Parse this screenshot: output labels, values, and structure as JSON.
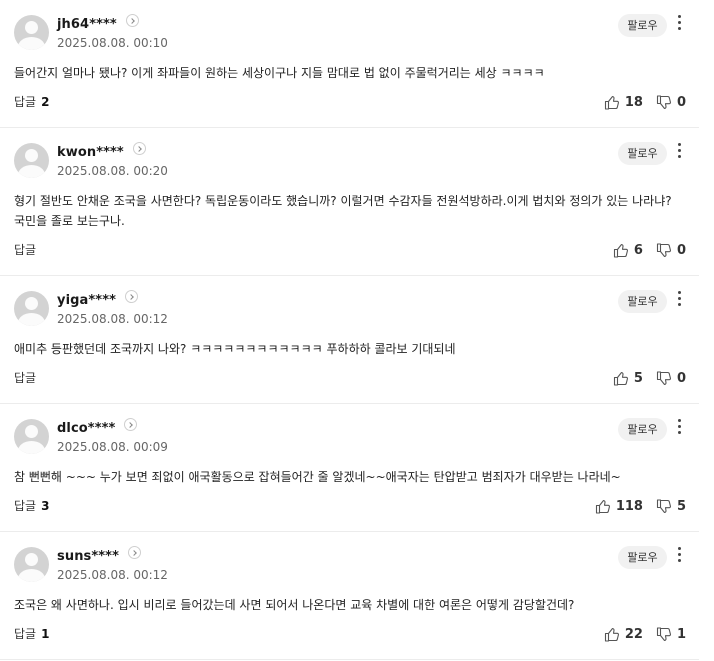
{
  "comments": [
    {
      "username": "jh64****",
      "date": "2025.08.08. 00:10",
      "follow_label": "팔로우",
      "text": "들어간지 얼마나 됐나? 이게 좌파들이 원하는 세상이구나 지들 맘대로 법 없이 주물럭거리는 세상 ㅋㅋㅋㅋ",
      "reply_label": "답글",
      "reply_count": "2",
      "likes": "18",
      "dislikes": "0"
    },
    {
      "username": "kwon****",
      "date": "2025.08.08. 00:20",
      "follow_label": "팔로우",
      "text": "형기 절반도 안채운 조국을 사면한다? 독립운동이라도 했습니까? 이럴거면 수감자들 전원석방하라.이게 법치와 정의가 있는 나라냐? 국민을 졸로 보는구나.",
      "reply_label": "답글",
      "reply_count": "",
      "likes": "6",
      "dislikes": "0"
    },
    {
      "username": "yiga****",
      "date": "2025.08.08. 00:12",
      "follow_label": "팔로우",
      "text": "애미추 등판했던데 조국까지 나와? ㅋㅋㅋㅋㅋㅋㅋㅋㅋㅋㅋㅋ 푸하하하 콜라보 기대되네",
      "reply_label": "답글",
      "reply_count": "",
      "likes": "5",
      "dislikes": "0"
    },
    {
      "username": "dlco****",
      "date": "2025.08.08. 00:09",
      "follow_label": "팔로우",
      "text": "참 뻔뻔해 ~~~ 누가 보면 죄없이 애국활동으로 잡혀들어간 줄 알겠네~~애국자는 탄압받고 범죄자가 대우받는 나라네~",
      "reply_label": "답글",
      "reply_count": "3",
      "likes": "118",
      "dislikes": "5"
    },
    {
      "username": "suns****",
      "date": "2025.08.08. 00:12",
      "follow_label": "팔로우",
      "text": "조국은 왜 사면하나. 입시 비리로 들어갔는데 사면 되어서 나온다면 교육 차별에 대한 여론은 어떻게 감당할건데?",
      "reply_label": "답글",
      "reply_count": "1",
      "likes": "22",
      "dislikes": "1"
    }
  ]
}
